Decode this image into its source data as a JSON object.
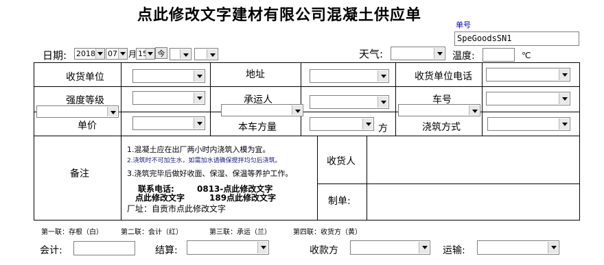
{
  "header": {
    "title": "点此修改文字建材有限公司混凝土供应单",
    "order_no_label": "单号",
    "order_no_value": "SpeGoodsSN1",
    "date_label": "日期:",
    "date_year": "2018",
    "date_month": "07",
    "date_month_unit": "月",
    "date_day": "15",
    "date_day_unit": "今",
    "weather_label": "天气:",
    "temperature_label": "温度:",
    "temperature_unit": "℃"
  },
  "form": {
    "receiver_unit_label": "收货单位",
    "address_label": "地址",
    "receiver_phone_label": "收货单位电话",
    "strength_label": "强度等级",
    "carrier_label": "承运人",
    "plate_label": "车号",
    "unit_price_label": "单价",
    "volume_label": "本车方量",
    "volume_unit": "方",
    "pour_method_label": "浇筑方式",
    "remarks_label": "备注",
    "consignee_label": "收货人",
    "maker_label": "制单:"
  },
  "notes": {
    "line1": "1.混凝土应在出厂两小时内浇筑入模为宜。",
    "line2": "2.浇筑时不可加生水，如需加水请确保搅拌均匀后浇筑。",
    "line3": "3.浇筑完毕后做好收面、保湿、保温等养护工作。",
    "contact_label": "联系电话:",
    "contact_phone1": "0813-点此修改文字",
    "contact_name": "点此修改文字",
    "contact_phone2": "189点此修改文字",
    "factory_address": "厂址：自贡市点此修改文字"
  },
  "copies": {
    "copy1": "第一联：存根（白）",
    "copy2": "第二联：会计（红）",
    "copy3": "第三联：承运（兰）",
    "copy4": "第四联：收货方（黄）"
  },
  "footer": {
    "accountant_label": "会计:",
    "settlement_label": "结算:",
    "payee_label": "收款方",
    "transport_label": "运输:"
  }
}
